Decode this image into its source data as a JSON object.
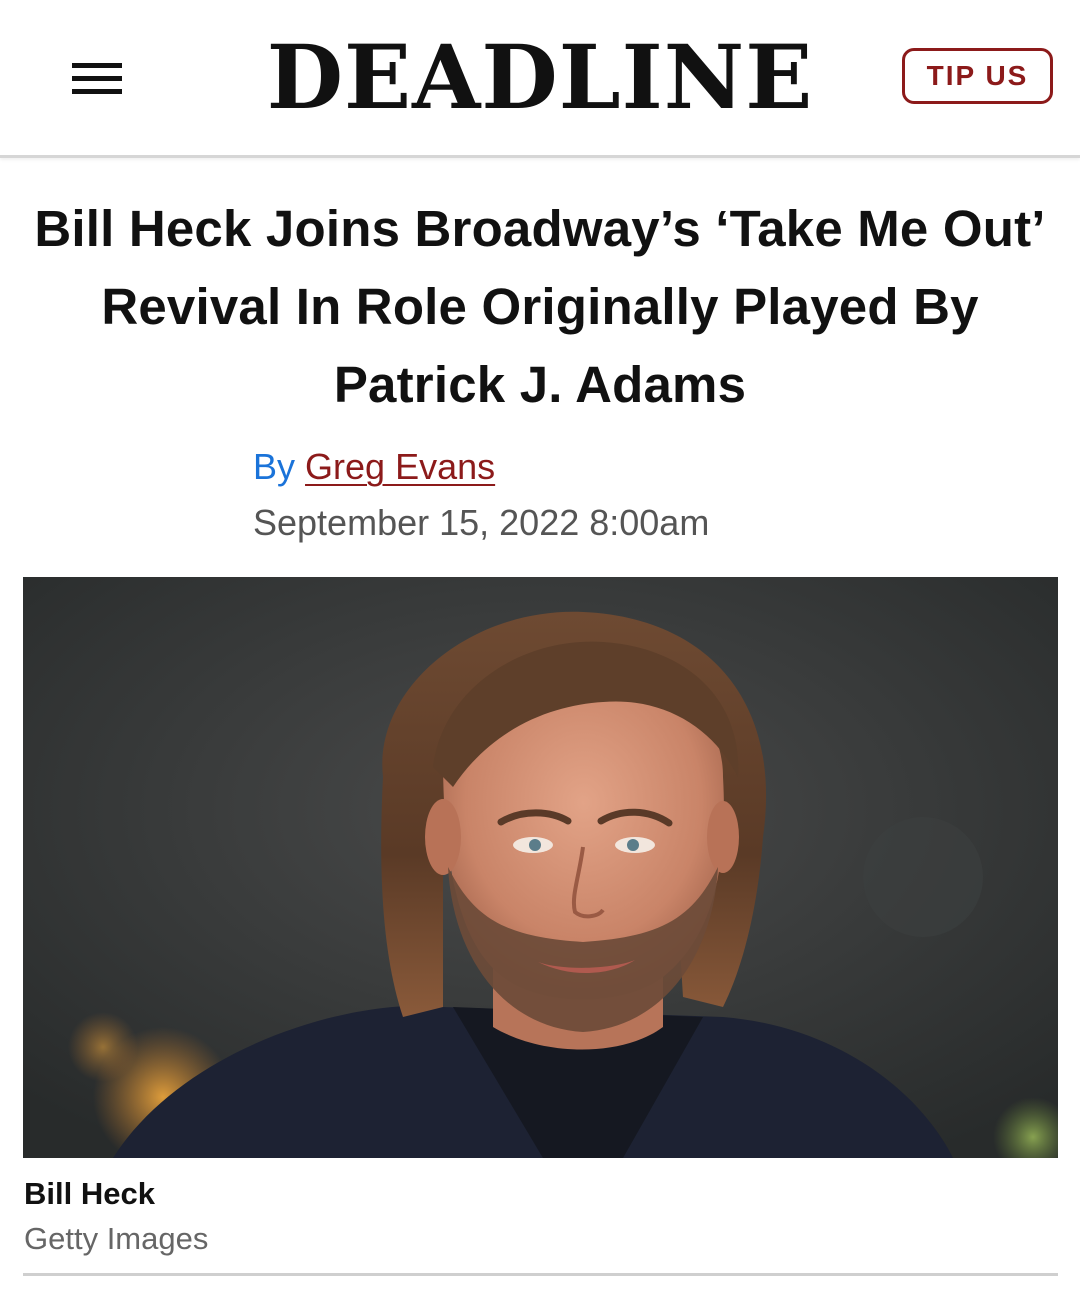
{
  "header": {
    "logo": "DEADLINE",
    "tip_label": "TIP US",
    "menu_icon": "hamburger-menu-icon",
    "accent_color": "#8c1a1a"
  },
  "article": {
    "headline": "Bill Heck Joins Broadway’s ‘Take Me Out’ Revival In Role Originally Played By Patrick J. Adams",
    "byline_prefix": "By",
    "author": "Greg Evans",
    "date": "September 15, 2022 8:00am",
    "byline_prefix_color": "#1a73d9"
  },
  "photo": {
    "caption_title": "Bill Heck",
    "caption_credit": "Getty Images"
  }
}
